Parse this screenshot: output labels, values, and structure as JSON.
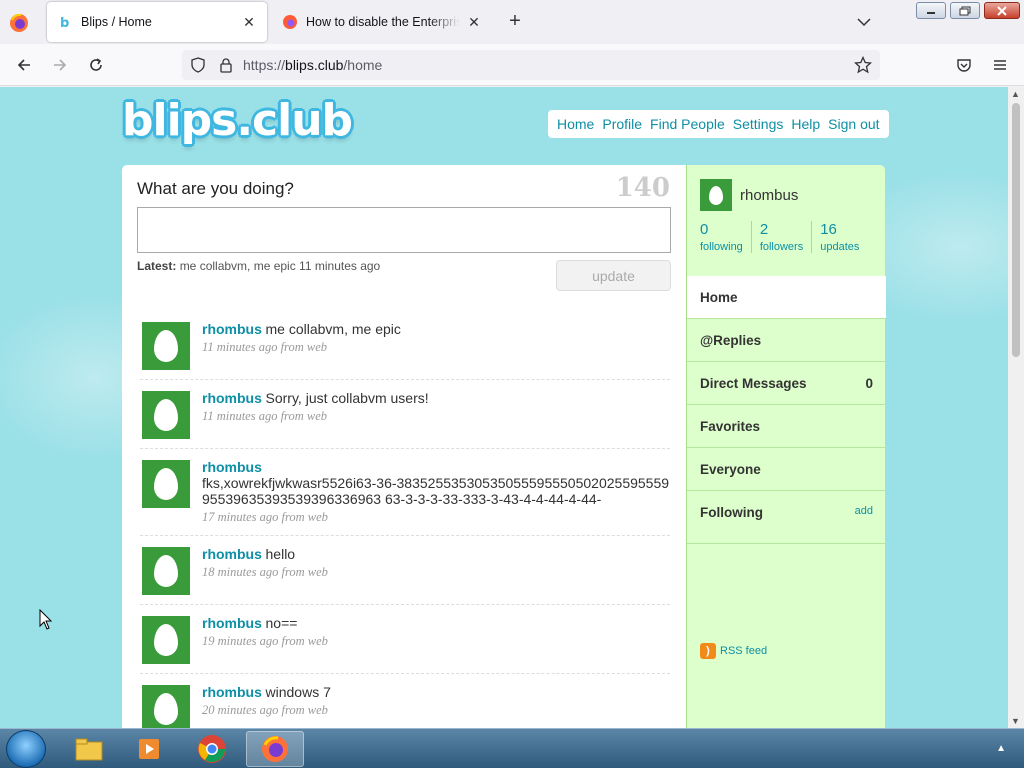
{
  "browser": {
    "tabs": [
      {
        "title": "Blips / Home",
        "active": true
      },
      {
        "title": "How to disable the Enterprise Ro",
        "active": false
      }
    ],
    "url_prefix": "https://",
    "url_host": "blips.club",
    "url_path": "/home"
  },
  "site": {
    "logo": "blips.club",
    "nav": [
      "Home",
      "Profile",
      "Find People",
      "Settings",
      "Help",
      "Sign out"
    ]
  },
  "composer": {
    "prompt": "What are you doing?",
    "counter": "140",
    "latest_label": "Latest:",
    "latest_text": "me collabvm, me epic 11 minutes ago",
    "update_label": "update"
  },
  "timeline": [
    {
      "user": "rhombus",
      "text": "me collabvm, me epic",
      "meta": "11 minutes ago from web"
    },
    {
      "user": "rhombus",
      "text": "Sorry, just collabvm users!",
      "meta": "11 minutes ago from web"
    },
    {
      "user": "rhombus",
      "text": "fks,xowrekfjwkwasr5526i63-36-3835255353053505559555050202559555995539635393539396336963 63-3-3-3-33-333-3-43-4-4-44-4-44-",
      "meta": "17 minutes ago from web"
    },
    {
      "user": "rhombus",
      "text": "hello",
      "meta": "18 minutes ago from web"
    },
    {
      "user": "rhombus",
      "text": "no==",
      "meta": "19 minutes ago from web"
    },
    {
      "user": "rhombus",
      "text": "windows 7",
      "meta": "20 minutes ago from web"
    }
  ],
  "sidebar": {
    "username": "rhombus",
    "stats": [
      {
        "num": "0",
        "label": "following"
      },
      {
        "num": "2",
        "label": "followers"
      },
      {
        "num": "16",
        "label": "updates"
      }
    ],
    "menu": [
      {
        "label": "Home",
        "count": ""
      },
      {
        "label": "@Replies",
        "count": ""
      },
      {
        "label": "Direct Messages",
        "count": "0"
      },
      {
        "label": "Favorites",
        "count": ""
      },
      {
        "label": "Everyone",
        "count": ""
      },
      {
        "label": "Following",
        "count": "add"
      }
    ],
    "rss_label": "RSS feed"
  },
  "colors": {
    "page_bg": "#9ae0e7",
    "link": "#0e8fa5",
    "sidebar_bg": "#ddffcc",
    "avatar": "#3a9b3a"
  },
  "icons": [
    "firefox-menu-icon",
    "blips-favicon",
    "firefox-favicon",
    "close-tab-icon",
    "new-tab-icon",
    "tab-list-icon",
    "back-icon",
    "forward-icon",
    "reload-icon",
    "shield-icon",
    "lock-icon",
    "bookmark-star-icon",
    "pocket-icon",
    "hamburger-menu-icon",
    "rss-icon",
    "egg-avatar-icon",
    "windows-start-icon",
    "explorer-icon",
    "media-player-icon",
    "chrome-icon",
    "firefox-icon"
  ]
}
